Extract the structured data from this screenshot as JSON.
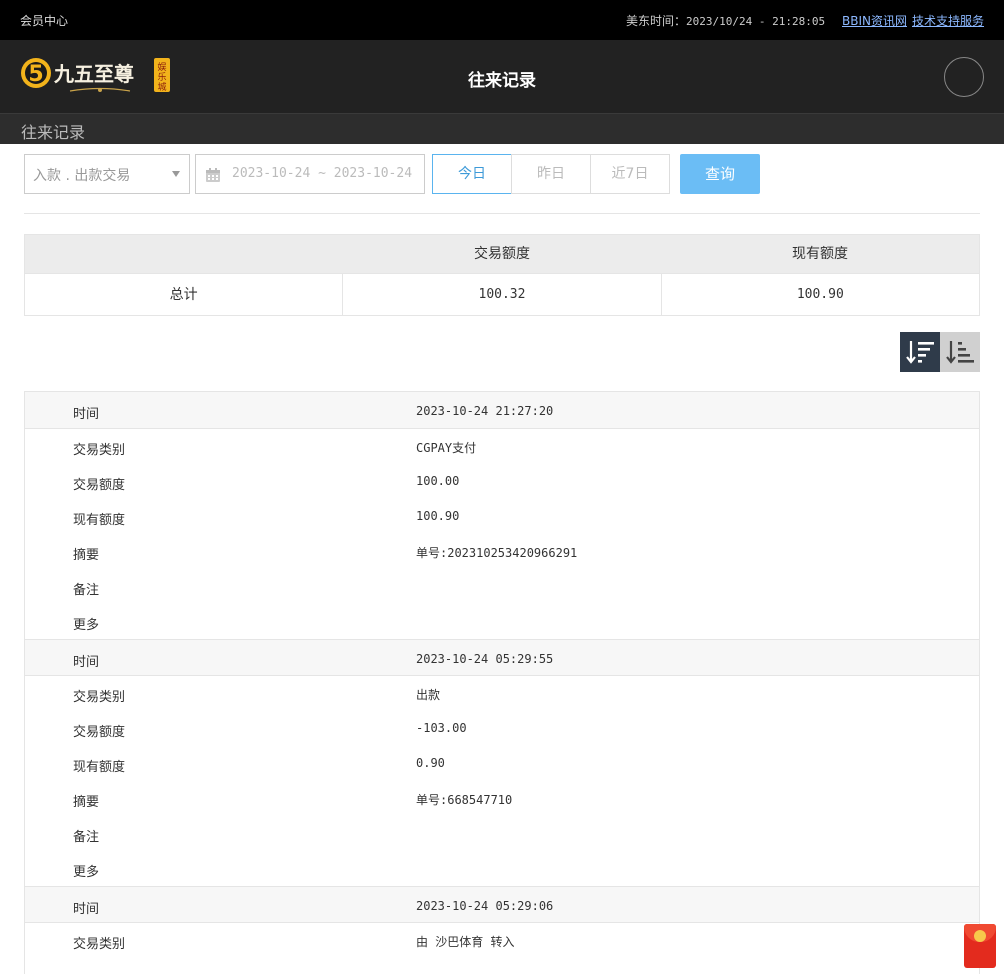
{
  "topbar": {
    "member_center": "会员中心",
    "time_label": "美东时间：",
    "time_value": "2023/10/24 - 21:28:05",
    "link_news": "BBIN资讯网",
    "link_support": "技术支持服务"
  },
  "header": {
    "logo_text": "九五至尊",
    "logo_sub": "娱乐城",
    "title": "往来记录"
  },
  "subheader": {
    "title": "往来记录"
  },
  "filters": {
    "type_select": "入款 . 出款交易",
    "date_start": "2023-10-24",
    "date_sep": "~",
    "date_end": "2023-10-24",
    "btn_today": "今日",
    "btn_yesterday": "昨日",
    "btn_week": "近7日",
    "btn_query": "查询"
  },
  "summary": {
    "headers": [
      "",
      "交易额度",
      "现有额度"
    ],
    "row": [
      "总计",
      "100.32",
      "100.90"
    ]
  },
  "records": [
    {
      "rows": [
        {
          "label": "时间",
          "value": "2023-10-24 21:27:20"
        },
        {
          "label": "交易类别",
          "value": "CGPAY支付"
        },
        {
          "label": "交易额度",
          "value": "100.00"
        },
        {
          "label": "现有额度",
          "value": "100.90"
        },
        {
          "label": "摘要",
          "value": "单号:202310253420966291"
        },
        {
          "label": "备注",
          "value": ""
        },
        {
          "label": "更多",
          "value": ""
        }
      ]
    },
    {
      "rows": [
        {
          "label": "时间",
          "value": "2023-10-24 05:29:55"
        },
        {
          "label": "交易类别",
          "value": "出款"
        },
        {
          "label": "交易额度",
          "value": "-103.00"
        },
        {
          "label": "现有额度",
          "value": "0.90"
        },
        {
          "label": "摘要",
          "value": "单号:668547710"
        },
        {
          "label": "备注",
          "value": ""
        },
        {
          "label": "更多",
          "value": ""
        }
      ]
    },
    {
      "rows": [
        {
          "label": "时间",
          "value": "2023-10-24 05:29:06"
        },
        {
          "label": "交易类别",
          "value": "由 沙巴体育 转入"
        }
      ]
    }
  ],
  "colors": {
    "accent": "#6bbdf5",
    "topbar_bg": "#000000",
    "header_bg": "#222222",
    "sort_active": "#2f3b4a"
  },
  "icons": [
    "calendar-icon",
    "sort-desc-icon",
    "sort-asc-icon",
    "red-packet-icon",
    "chevron-down-icon"
  ]
}
